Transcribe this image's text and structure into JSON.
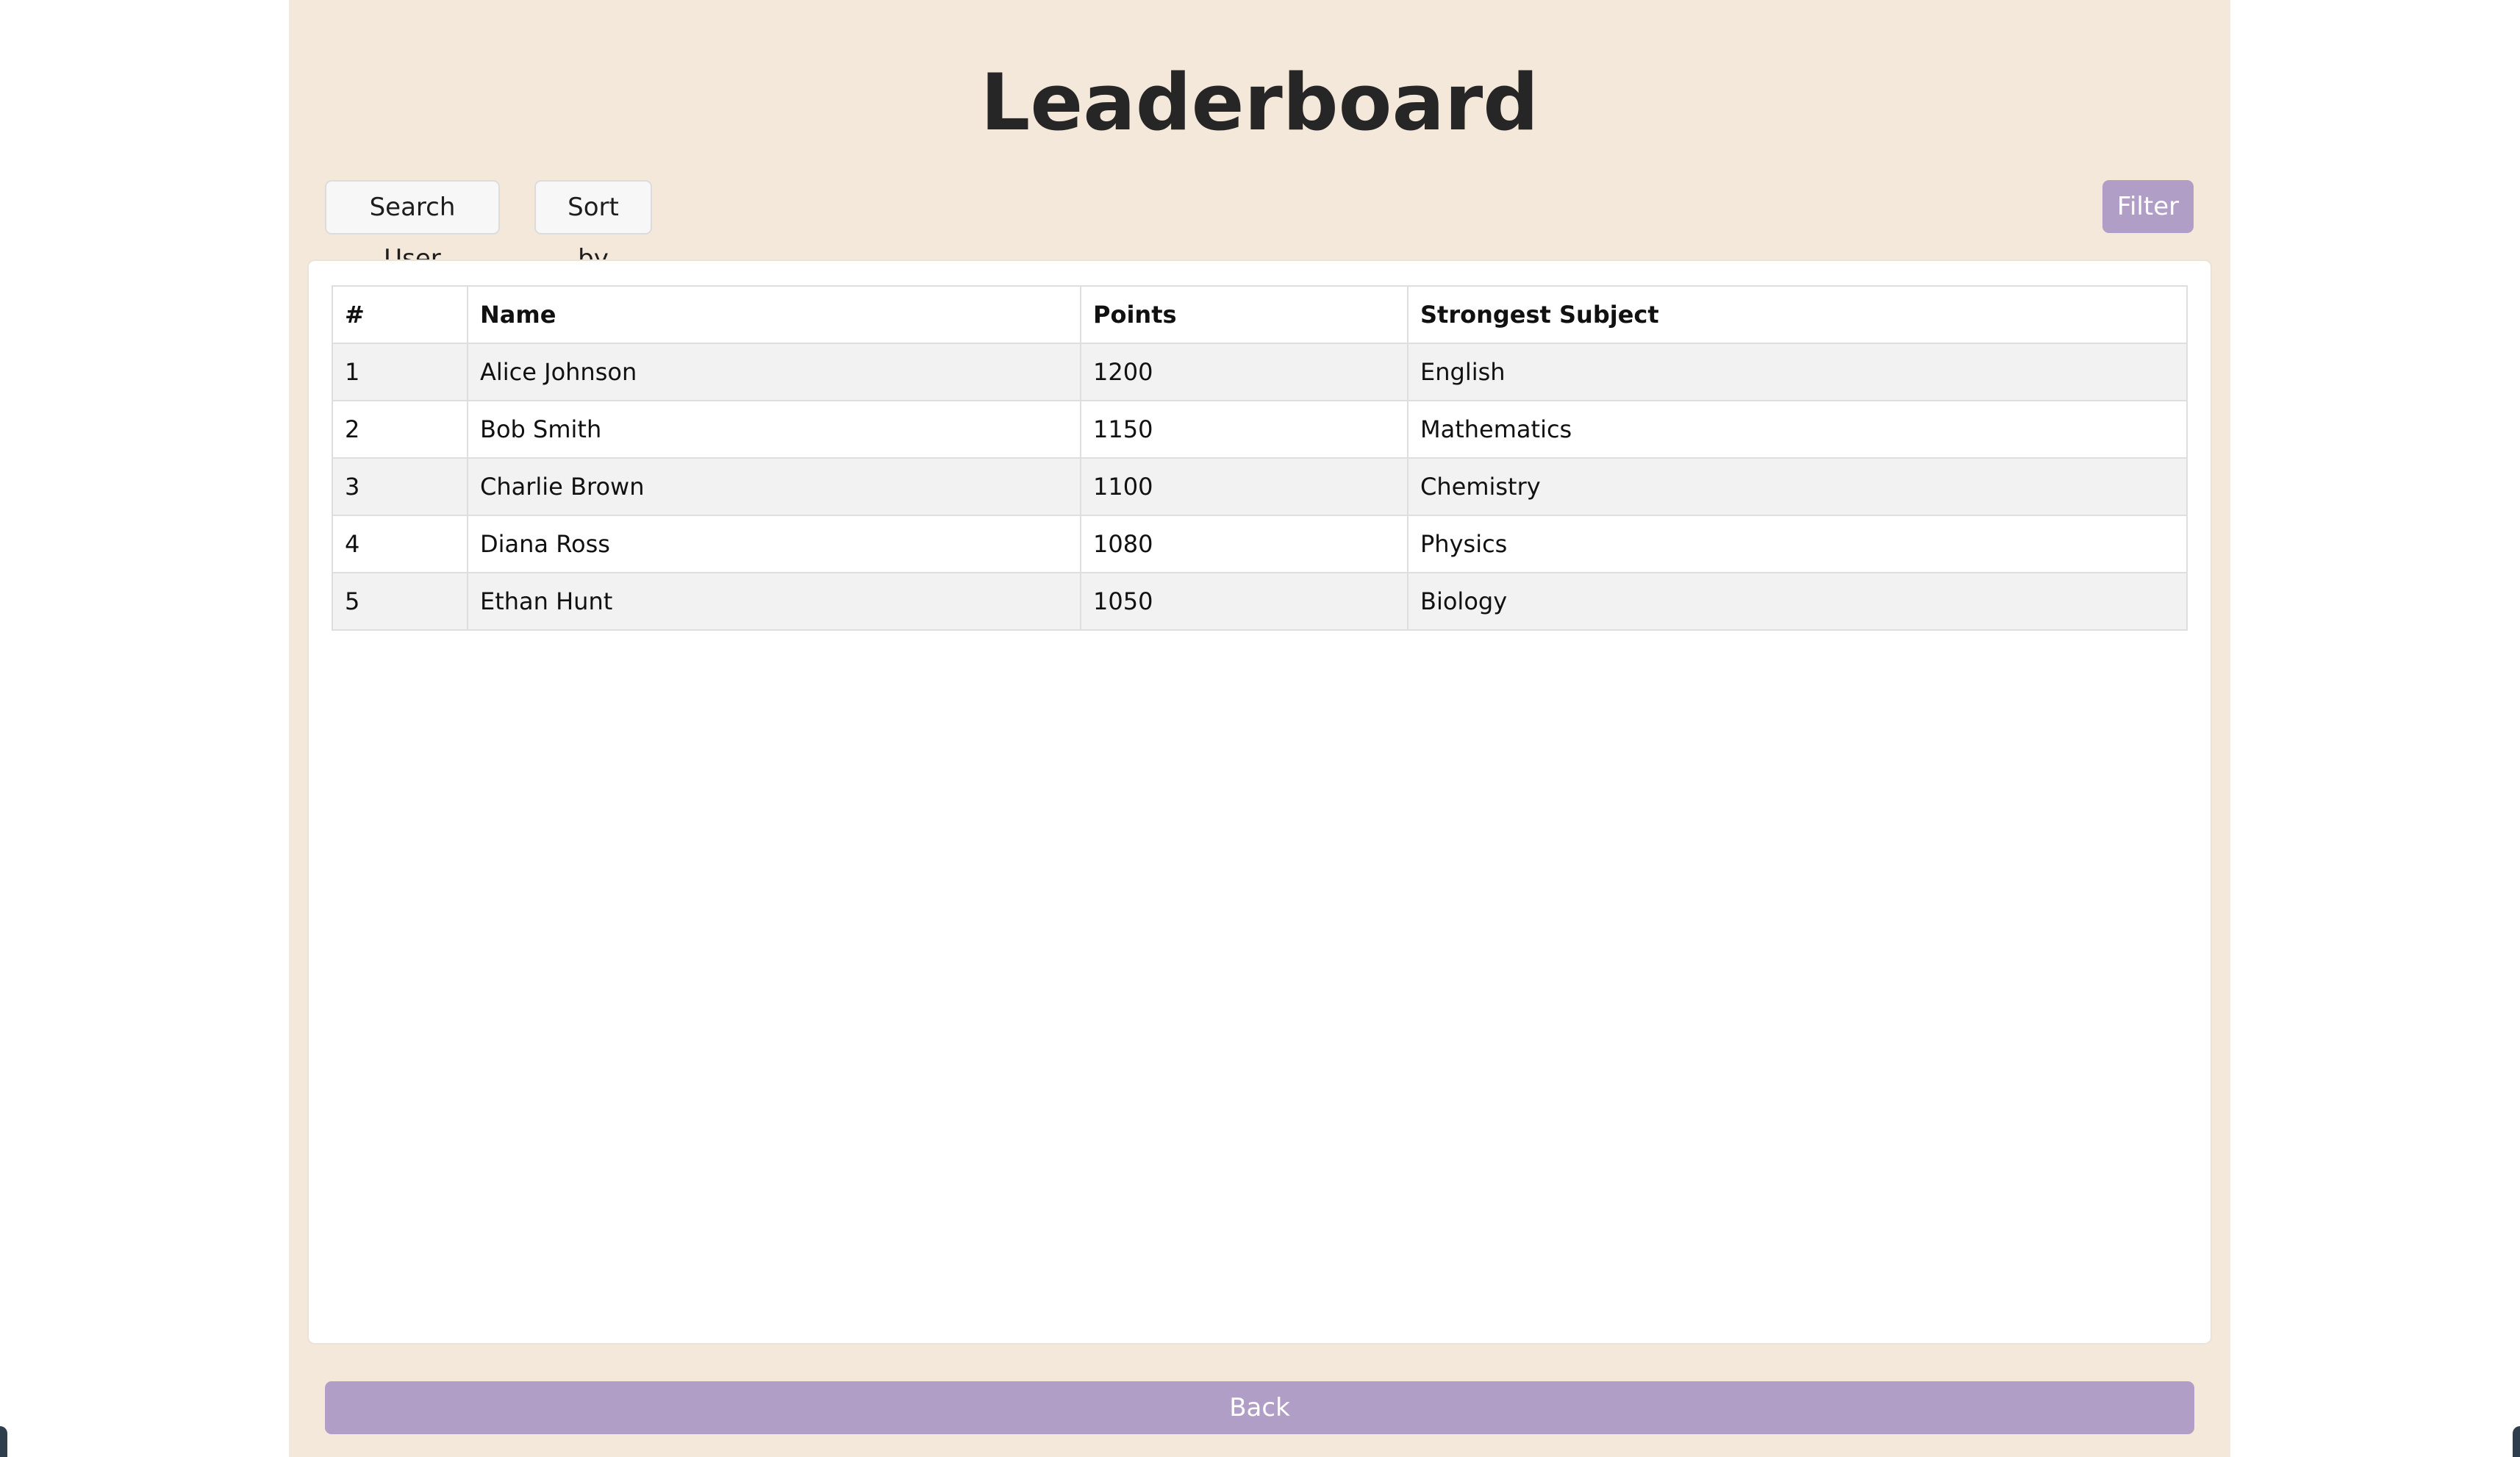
{
  "header": {
    "title": "Leaderboard"
  },
  "toolbar": {
    "search_label": "Search User",
    "sort_label": "Sort by",
    "filter_label": "Filter"
  },
  "table": {
    "columns": [
      "#",
      "Name",
      "Points",
      "Strongest Subject"
    ],
    "rows": [
      [
        "1",
        "Alice Johnson",
        "1200",
        "English"
      ],
      [
        "2",
        "Bob Smith",
        "1150",
        "Mathematics"
      ],
      [
        "3",
        "Charlie Brown",
        "1100",
        "Chemistry"
      ],
      [
        "4",
        "Diana Ross",
        "1080",
        "Physics"
      ],
      [
        "5",
        "Ethan Hunt",
        "1050",
        "Biology"
      ]
    ]
  },
  "footer": {
    "back_label": "Back"
  },
  "colors": {
    "panel_background": "#f4e8da",
    "accent_button": "#b09ec7",
    "row_stripe": "#f2f2f2"
  }
}
